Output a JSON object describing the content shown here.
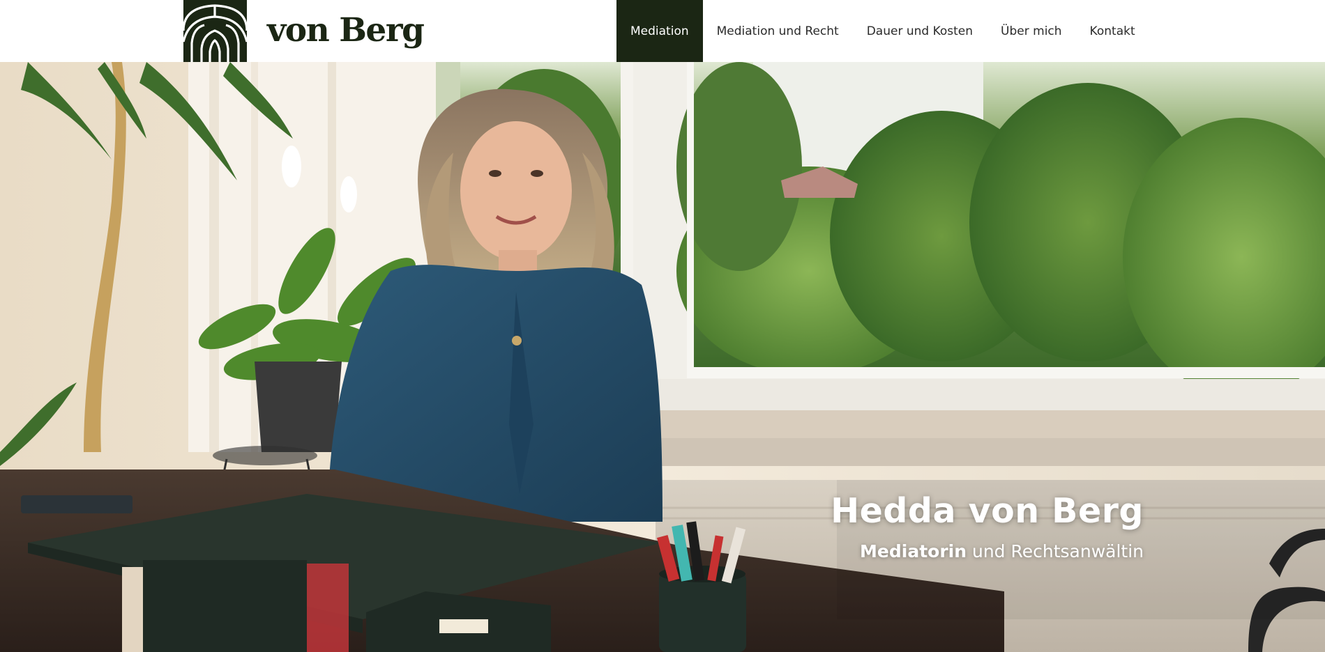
{
  "header": {
    "logo_text": "von Berg",
    "logo_icon": "arches-logo-icon",
    "nav": [
      {
        "label": "Mediation",
        "active": true
      },
      {
        "label": "Mediation und Recht",
        "active": false
      },
      {
        "label": "Dauer und Kosten",
        "active": false
      },
      {
        "label": "Über mich",
        "active": false
      },
      {
        "label": "Kontakt",
        "active": false
      }
    ]
  },
  "hero": {
    "image": "portrait-photo-office-window",
    "title": "Hedda von Berg",
    "subtitle_strong": "Mediatorin",
    "subtitle_rest": " und Rechtsanwältin"
  },
  "colors": {
    "brand_dark": "#1b2614",
    "nav_text": "#2b2b2b",
    "hero_text": "#ffffff"
  }
}
